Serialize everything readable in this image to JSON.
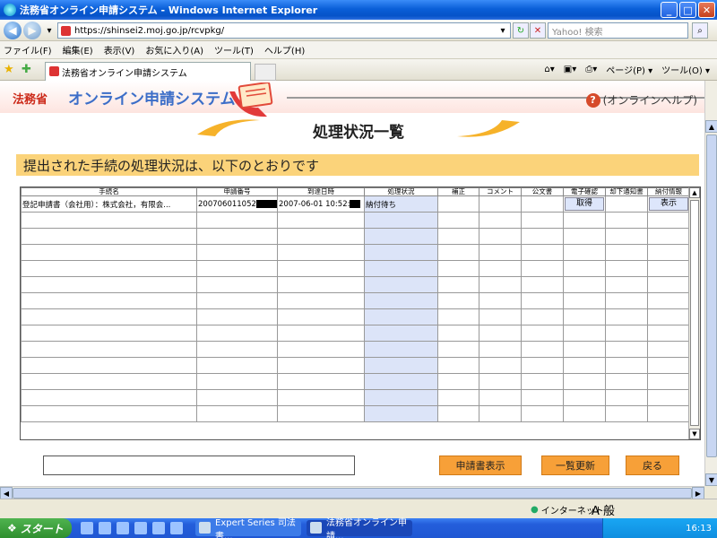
{
  "window": {
    "title": "法務省オンライン申請システム - Windows Internet Explorer"
  },
  "address": {
    "url": "https://shinsei2.moj.go.jp/rcvpkg/",
    "search_placeholder": "Yahoo! 検索"
  },
  "menu": [
    "ファイル(F)",
    "編集(E)",
    "表示(V)",
    "お気に入り(A)",
    "ツール(T)",
    "ヘルプ(H)"
  ],
  "tab": {
    "title": "法務省オンライン申請システム"
  },
  "toolbar": {
    "page_label": "ページ(P) ▾",
    "tools_label": "ツール(O) ▾"
  },
  "site": {
    "ministry": "法務省",
    "system_name": "オンライン申請システム",
    "help": "(オンラインヘルプ)"
  },
  "page": {
    "heading": "処理状況一覧",
    "notice": "提出された手続の処理状況は、以下のとおりです"
  },
  "table": {
    "headers": [
      "手続名",
      "申請番号",
      "到達日時",
      "処理状況",
      "補正",
      "コメント",
      "公文書",
      "電子確認",
      "却下通知書",
      "納付情報"
    ],
    "rows": [
      {
        "procedure": "登記申請書（会社用）：株式会社，有限会...",
        "app_no": "200706011052",
        "arrival": "2007-06-01 10:52:",
        "status": "納付待ち",
        "confirm_btn": "取得",
        "payment_btn": "表示"
      }
    ]
  },
  "buttons": {
    "view_application": "申請書表示",
    "refresh_list": "一覧更新",
    "back": "戻る"
  },
  "statusbar": {
    "zone": "インターネット",
    "ime": "A 般"
  },
  "taskbar": {
    "start": "スタート",
    "tasks": [
      "Expert Series 司法書...",
      "法務省オンライン申請..."
    ],
    "clock": "16:13"
  }
}
